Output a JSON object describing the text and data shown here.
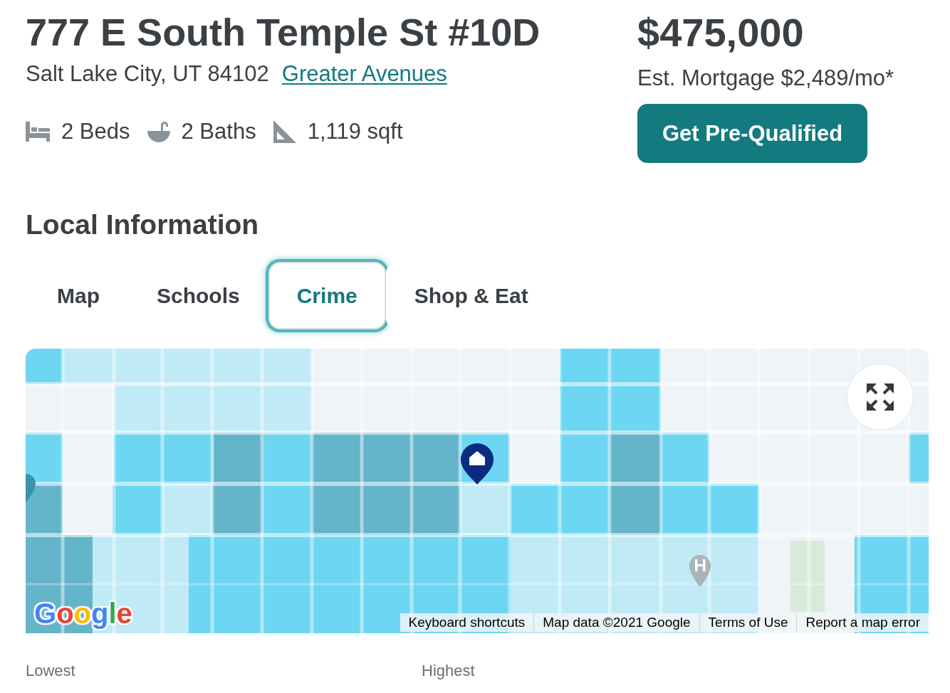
{
  "listing": {
    "address": "777 E South Temple St #10D",
    "city_line": "Salt Lake City, UT 84102",
    "neighborhood_link": "Greater Avenues",
    "features": [
      {
        "kind": "beds",
        "text": "2 Beds"
      },
      {
        "kind": "baths",
        "text": "2 Baths"
      },
      {
        "kind": "area",
        "text": "1,119 sqft"
      }
    ]
  },
  "pricing": {
    "price": "$475,000",
    "mortgage": "Est. Mortgage $2,489/mo*",
    "cta_button": "Get Pre-Qualified"
  },
  "local_info": {
    "heading": "Local Information",
    "tabs": [
      {
        "label": "Map",
        "selected": false
      },
      {
        "label": "Schools",
        "selected": false
      },
      {
        "label": "Crime",
        "selected": true
      },
      {
        "label": "Shop & Eat",
        "selected": false
      }
    ]
  },
  "map": {
    "logo": "Google",
    "attribution": [
      "Keyboard shortcuts",
      "Map data ©2021 Google",
      "Terms of Use",
      "Report a map error"
    ]
  },
  "legend": {
    "low": "Lowest",
    "high": "Highest"
  }
}
